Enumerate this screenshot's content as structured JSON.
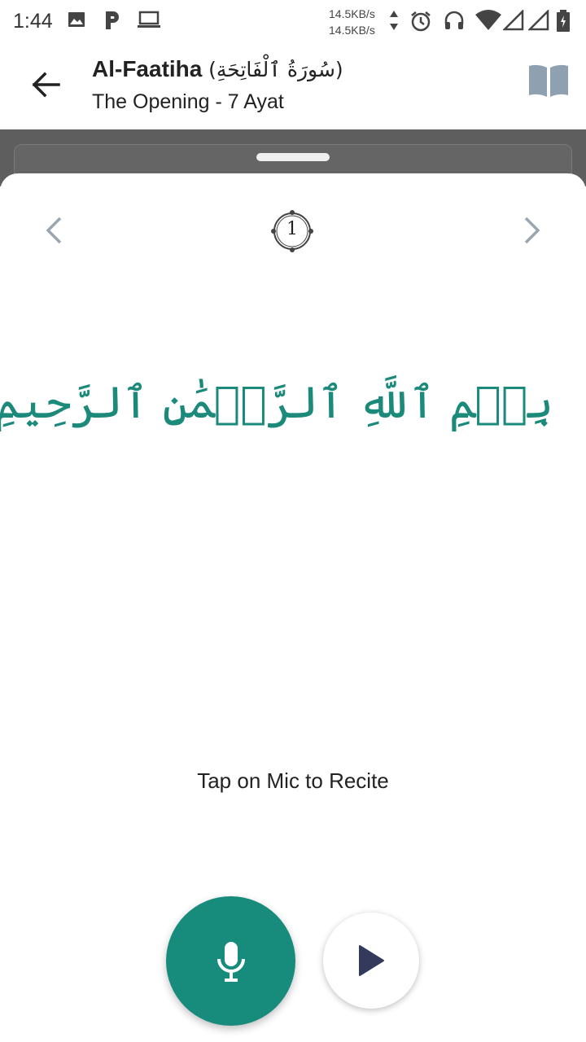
{
  "status_bar": {
    "time": "1:44",
    "speed_up": "14.5KB/s",
    "speed_down": "14.5KB/s",
    "icons": [
      "image-icon",
      "parking-icon",
      "laptop-icon",
      "data-arrows-icon",
      "alarm-icon",
      "headphones-icon",
      "wifi-icon",
      "signal-icon",
      "signal-icon",
      "battery-icon"
    ]
  },
  "header": {
    "title": "Al-Faatiha",
    "title_arabic": "(سُورَةُ ٱلْفَاتِحَةِ)",
    "subtitle": "The Opening - 7 Ayat",
    "back_icon": "arrow-left-icon",
    "book_icon": "book-open-icon"
  },
  "sheet": {
    "ayah_number": "1",
    "ayah_text": "بِسۡمِ ٱللَّهِ ٱلرَّحۡمَٰنِ ٱلرَّحِيمِ",
    "hint": "Tap on Mic to Recite",
    "prev_icon": "chevron-left-icon",
    "next_icon": "chevron-right-icon",
    "mic_icon": "microphone-icon",
    "play_icon": "play-icon"
  },
  "colors": {
    "accent": "#178b7c",
    "ayah_text": "#1b8a7a",
    "nav_chevron": "#9aa6b0",
    "book_icon": "#8fa1b0",
    "play_icon": "#333a5c"
  }
}
